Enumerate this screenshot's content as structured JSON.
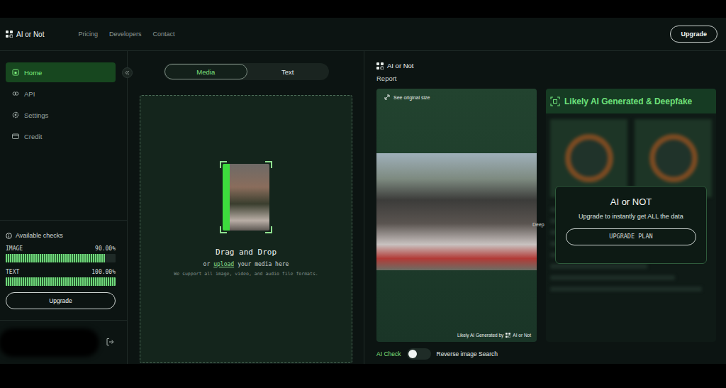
{
  "header": {
    "logo": "AI or Not",
    "nav": [
      {
        "label": "Pricing"
      },
      {
        "label": "Developers"
      },
      {
        "label": "Contact"
      }
    ],
    "upgrade": "Upgrade"
  },
  "sidebar": {
    "items": [
      {
        "label": "Home",
        "selected": true
      },
      {
        "label": "API",
        "selected": false
      },
      {
        "label": "Settings",
        "selected": false
      },
      {
        "label": "Credit",
        "selected": false
      }
    ],
    "checks": {
      "title": "Available checks",
      "meters": [
        {
          "label": "IMAGE",
          "reading": "90.00%",
          "level": 0.9
        },
        {
          "label": "TEXT",
          "reading": "100.00%",
          "level": 1
        }
      ]
    },
    "upgrade": "Upgrade"
  },
  "upload": {
    "tabs": [
      {
        "label": "Media",
        "selected": true
      },
      {
        "label": "Text",
        "selected": false
      }
    ],
    "title": "Drag and Drop",
    "prefix": "or",
    "link": "upload",
    "suffix": "your media here",
    "note": "We support all image, video, and audio file formats."
  },
  "report": {
    "logo": "AI or Not",
    "title": "Report",
    "see_original": "See original size",
    "side_label": "Deep",
    "badge_text": "Likely AI Generated by",
    "badge_logo": "AI or Not",
    "verdict": "Likely AI Generated & Deepfake",
    "overlay": {
      "title": "AI or NOT",
      "text": "Upgrade to instantly get ALL the data",
      "button": "UPGRADE PLAN"
    },
    "modes": [
      {
        "label": "AI Check",
        "selected": true
      },
      {
        "label": "Reverse image Search",
        "selected": false
      }
    ]
  }
}
